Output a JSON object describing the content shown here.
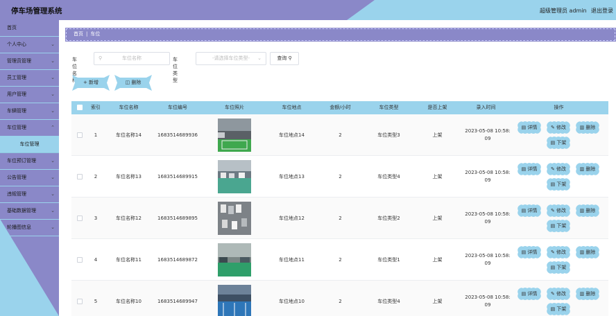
{
  "header": {
    "title": "停车场管理系统",
    "user": "超级管理员 admin",
    "logout": "退出登录"
  },
  "sidebar": {
    "items": [
      {
        "label": "首页",
        "chevron": false
      },
      {
        "label": "个人中心",
        "chevron": true
      },
      {
        "label": "管理员管理",
        "chevron": true
      },
      {
        "label": "员工管理",
        "chevron": true
      },
      {
        "label": "用户管理",
        "chevron": true
      },
      {
        "label": "车辆管理",
        "chevron": true
      },
      {
        "label": "车位管理",
        "chevron": true,
        "expanded": true
      },
      {
        "label": "车位管理",
        "sub": true
      },
      {
        "label": "车位预订管理",
        "chevron": true
      },
      {
        "label": "公告管理",
        "chevron": true
      },
      {
        "label": "违规管理",
        "chevron": true
      },
      {
        "label": "基础数据管理",
        "chevron": true
      },
      {
        "label": "轮播图信息",
        "chevron": true
      }
    ]
  },
  "breadcrumb": {
    "home": "首页",
    "current": "车位"
  },
  "search": {
    "name_label": "车位名称",
    "name_placeholder": "车位名称",
    "type_label": "车位类型",
    "type_placeholder": "-请选择车位类型-",
    "query_label": "查询"
  },
  "actions": {
    "add": "新增",
    "delete": "删除"
  },
  "table": {
    "columns": [
      "索引",
      "车位名称",
      "车位编号",
      "车位照片",
      "车位地点",
      "金额/小时",
      "车位类型",
      "是否上架",
      "录入时间",
      "操作"
    ],
    "row_buttons": {
      "detail": "详情",
      "edit": "修改",
      "delete": "删除",
      "off": "下架"
    },
    "rows": [
      {
        "index": "1",
        "name": "车位名称14",
        "code": "1683514689936",
        "place": "车位地点14",
        "price": "2",
        "type": "车位类型3",
        "status": "上架",
        "time1": "2023-05-08 10:58:",
        "time2": "09"
      },
      {
        "index": "2",
        "name": "车位名称13",
        "code": "1683514689915",
        "place": "车位地点13",
        "price": "2",
        "type": "车位类型4",
        "status": "上架",
        "time1": "2023-05-08 10:58:",
        "time2": "09"
      },
      {
        "index": "3",
        "name": "车位名称12",
        "code": "1683514689895",
        "place": "车位地点12",
        "price": "2",
        "type": "车位类型2",
        "status": "上架",
        "time1": "2023-05-08 10:58:",
        "time2": "09"
      },
      {
        "index": "4",
        "name": "车位名称11",
        "code": "1683514689872",
        "place": "车位地点11",
        "price": "2",
        "type": "车位类型1",
        "status": "上架",
        "time1": "2023-05-08 10:58:",
        "time2": "09"
      },
      {
        "index": "5",
        "name": "车位名称10",
        "code": "1683514689947",
        "place": "车位地点10",
        "price": "2",
        "type": "车位类型4",
        "status": "上架",
        "time1": "2023-05-08 10:58:",
        "time2": "09"
      }
    ]
  },
  "colors": {
    "primary": "#8a88c8",
    "accent": "#9ad3ec"
  },
  "icons": {
    "search": "search-icon",
    "plus": "plus-icon",
    "trash": "trash-icon",
    "doc": "document-icon",
    "edit": "edit-icon",
    "chevron": "chevron-down-icon"
  }
}
